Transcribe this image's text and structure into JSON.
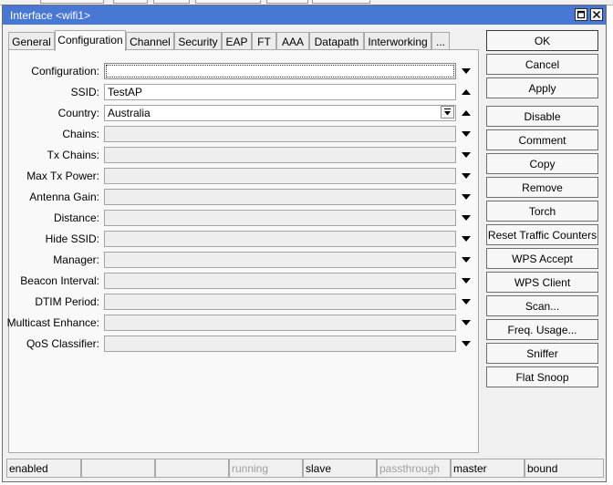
{
  "window": {
    "title": "Interface <wifi1>"
  },
  "tabs": [
    {
      "label": "General"
    },
    {
      "label": "Configuration"
    },
    {
      "label": "Channel"
    },
    {
      "label": "Security"
    },
    {
      "label": "EAP"
    },
    {
      "label": "FT"
    },
    {
      "label": "AAA"
    },
    {
      "label": "Datapath"
    },
    {
      "label": "Interworking"
    },
    {
      "label": "..."
    }
  ],
  "active_tab": "Configuration",
  "fields": [
    {
      "label": "Configuration:",
      "value": "",
      "arrow": "down"
    },
    {
      "label": "SSID:",
      "value": "TestAP",
      "arrow": "up"
    },
    {
      "label": "Country:",
      "value": "Australia",
      "arrow": "up"
    },
    {
      "label": "Chains:",
      "value": "",
      "arrow": "down"
    },
    {
      "label": "Tx Chains:",
      "value": "",
      "arrow": "down"
    },
    {
      "label": "Max Tx Power:",
      "value": "",
      "arrow": "down"
    },
    {
      "label": "Antenna Gain:",
      "value": "",
      "arrow": "down"
    },
    {
      "label": "Distance:",
      "value": "",
      "arrow": "down"
    },
    {
      "label": "Hide SSID:",
      "value": "",
      "arrow": "down"
    },
    {
      "label": "Manager:",
      "value": "",
      "arrow": "down"
    },
    {
      "label": "Beacon Interval:",
      "value": "",
      "arrow": "down"
    },
    {
      "label": "DTIM Period:",
      "value": "",
      "arrow": "down"
    },
    {
      "label": "Multicast Enhance:",
      "value": "",
      "arrow": "down"
    },
    {
      "label": "QoS Classifier:",
      "value": "",
      "arrow": "down"
    }
  ],
  "buttons": [
    {
      "label": "OK"
    },
    {
      "label": "Cancel"
    },
    {
      "label": "Apply"
    },
    {
      "label": "Disable"
    },
    {
      "label": "Comment"
    },
    {
      "label": "Copy"
    },
    {
      "label": "Remove"
    },
    {
      "label": "Torch"
    },
    {
      "label": "Reset Traffic Counters"
    },
    {
      "label": "WPS Accept"
    },
    {
      "label": "WPS Client"
    },
    {
      "label": "Scan..."
    },
    {
      "label": "Freq. Usage..."
    },
    {
      "label": "Sniffer"
    },
    {
      "label": "Flat Snoop"
    }
  ],
  "status": [
    {
      "text": "enabled",
      "dim": false
    },
    {
      "text": "",
      "dim": false
    },
    {
      "text": "",
      "dim": false
    },
    {
      "text": "running",
      "dim": true
    },
    {
      "text": "slave",
      "dim": false
    },
    {
      "text": "passthrough",
      "dim": true
    },
    {
      "text": "master",
      "dim": false
    },
    {
      "text": "bound",
      "dim": false
    }
  ],
  "colors": {
    "titlebar": "#4877d4",
    "dialog_bg": "#f0f0f0",
    "disabled_text": "#a0a0a0"
  }
}
